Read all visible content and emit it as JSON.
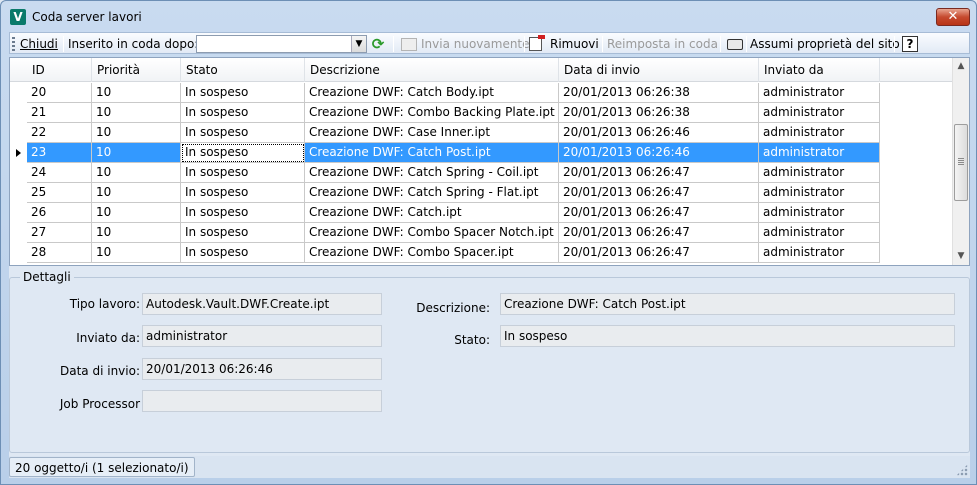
{
  "window": {
    "title": "Coda server lavori",
    "close_label": "✕"
  },
  "toolbar": {
    "close_label": "Chiudi",
    "queued_after_label": "Inserito in coda dopo:",
    "queued_after_value": "",
    "resend_label": "Invia nuovamente",
    "remove_label": "Rimuovi",
    "reset_label": "Reimposta in coda",
    "site_props_label": "Assumi proprietà del sito",
    "help_label": "?"
  },
  "grid": {
    "columns": [
      "ID",
      "Priorità",
      "Stato",
      "Descrizione",
      "Data di invio",
      "Inviato da"
    ],
    "rows": [
      [
        "20",
        "10",
        "In sospeso",
        "Creazione DWF: Catch Body.ipt",
        "20/01/2013 06:26:38",
        "administrator"
      ],
      [
        "21",
        "10",
        "In sospeso",
        "Creazione DWF: Combo Backing Plate.ipt",
        "20/01/2013 06:26:38",
        "administrator"
      ],
      [
        "22",
        "10",
        "In sospeso",
        "Creazione DWF: Case Inner.ipt",
        "20/01/2013 06:26:46",
        "administrator"
      ],
      [
        "23",
        "10",
        "In sospeso",
        "Creazione DWF: Catch Post.ipt",
        "20/01/2013 06:26:46",
        "administrator"
      ],
      [
        "24",
        "10",
        "In sospeso",
        "Creazione DWF: Catch Spring - Coil.ipt",
        "20/01/2013 06:26:47",
        "administrator"
      ],
      [
        "25",
        "10",
        "In sospeso",
        "Creazione DWF: Catch Spring - Flat.ipt",
        "20/01/2013 06:26:47",
        "administrator"
      ],
      [
        "26",
        "10",
        "In sospeso",
        "Creazione DWF: Catch.ipt",
        "20/01/2013 06:26:47",
        "administrator"
      ],
      [
        "27",
        "10",
        "In sospeso",
        "Creazione DWF: Combo Spacer Notch.ipt",
        "20/01/2013 06:26:47",
        "administrator"
      ],
      [
        "28",
        "10",
        "In sospeso",
        "Creazione DWF: Combo Spacer.ipt",
        "20/01/2013 06:26:47",
        "administrator"
      ]
    ],
    "selected_index": 3
  },
  "details": {
    "legend": "Dettagli",
    "tipo_lavoro_label": "Tipo lavoro:",
    "tipo_lavoro_value": "Autodesk.Vault.DWF.Create.ipt",
    "inviato_da_label": "Inviato da:",
    "inviato_da_value": "administrator",
    "data_invio_label": "Data di invio:",
    "data_invio_value": "20/01/2013 06:26:46",
    "job_processor_label": "Job Processor",
    "job_processor_value": "",
    "descrizione_label": "Descrizione:",
    "descrizione_value": "Creazione DWF: Catch Post.ipt",
    "stato_label": "Stato:",
    "stato_value": "In sospeso"
  },
  "status": {
    "text": "20 oggetto/i (1 selezionato/i)"
  },
  "colors": {
    "selection": "#3399ff",
    "accent": "#0a7a6a"
  }
}
